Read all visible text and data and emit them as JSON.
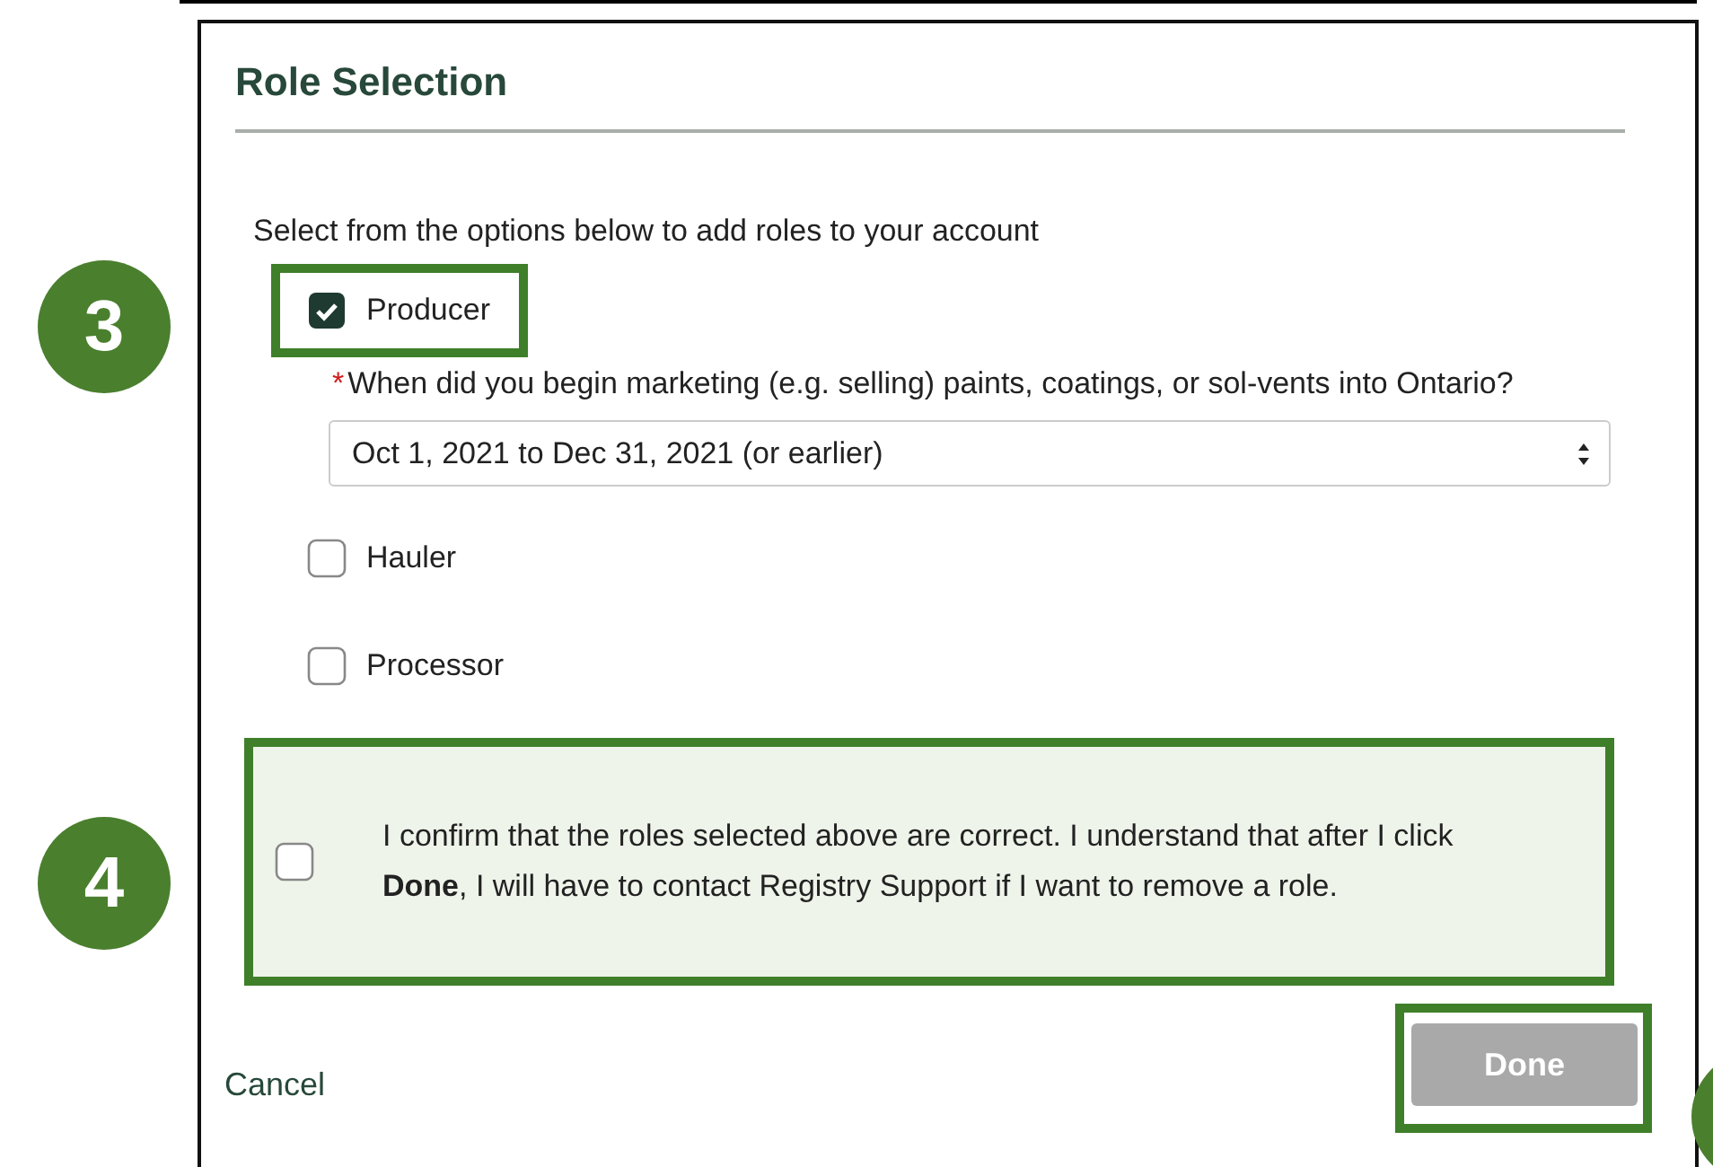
{
  "dialog": {
    "title": "Role Selection",
    "intro": "Select from the options below to add roles to your account",
    "roles": [
      {
        "label": "Producer",
        "checked": true,
        "highlighted": true,
        "question": {
          "marker": "*",
          "text": "When did you begin marketing (e.g. selling) paints, coatings, or sol-vents into Ontario?",
          "value": "Oct 1, 2021 to Dec 31, 2021 (or earlier)"
        }
      },
      {
        "label": "Hauler",
        "checked": false,
        "highlighted": false
      },
      {
        "label": "Processor",
        "checked": false,
        "highlighted": false
      }
    ],
    "confirm": {
      "text": "I confirm that the roles selected above are correct. I understand that after I click **Done**, I will have to contact Registry Support if I want to remove a role.",
      "checked": false,
      "highlighted": true
    },
    "cancel": "Cancel",
    "done": {
      "label": "Done",
      "disabled": true,
      "highlighted": true
    }
  },
  "callouts": [
    {
      "kind": "numbered",
      "label": "3"
    },
    {
      "kind": "numbered",
      "label": "4"
    },
    {
      "kind": "cut"
    }
  ]
}
